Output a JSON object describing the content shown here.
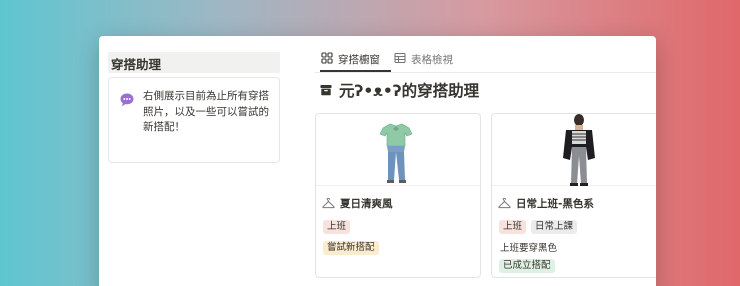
{
  "sidebar": {
    "title": "穿搭助理",
    "note_lines": [
      "右側展示目前為止所有穿搭",
      "照片，以及一些可以嘗試的",
      "新搭配！"
    ]
  },
  "tabs": [
    {
      "label": "穿搭櫥窗",
      "icon": "gallery-grid-icon",
      "active": true
    },
    {
      "label": "表格檢視",
      "icon": "table-icon",
      "active": false
    }
  ],
  "database": {
    "icon": "archive-icon",
    "title": "元ʔ•ᴥ•ʔ的穿搭助理"
  },
  "cards": [
    {
      "name": "夏日清爽風",
      "icon": "hanger-icon",
      "image": "green-tshirt-jeans-outfit",
      "tags": [
        {
          "label": "上班",
          "color": "#f7e2dd"
        }
      ],
      "description": "",
      "status": {
        "label": "嘗試新搭配",
        "color": "#fbeccd"
      }
    },
    {
      "name": "日常上班-黑色系",
      "icon": "hanger-icon",
      "image": "black-jacket-outfit-photo",
      "tags": [
        {
          "label": "上班",
          "color": "#f7e2dd"
        },
        {
          "label": "日常上課",
          "color": "#ebeced"
        }
      ],
      "description": "上班要穿黑色",
      "status": {
        "label": "已成立搭配",
        "color": "#dff0e4"
      }
    }
  ]
}
